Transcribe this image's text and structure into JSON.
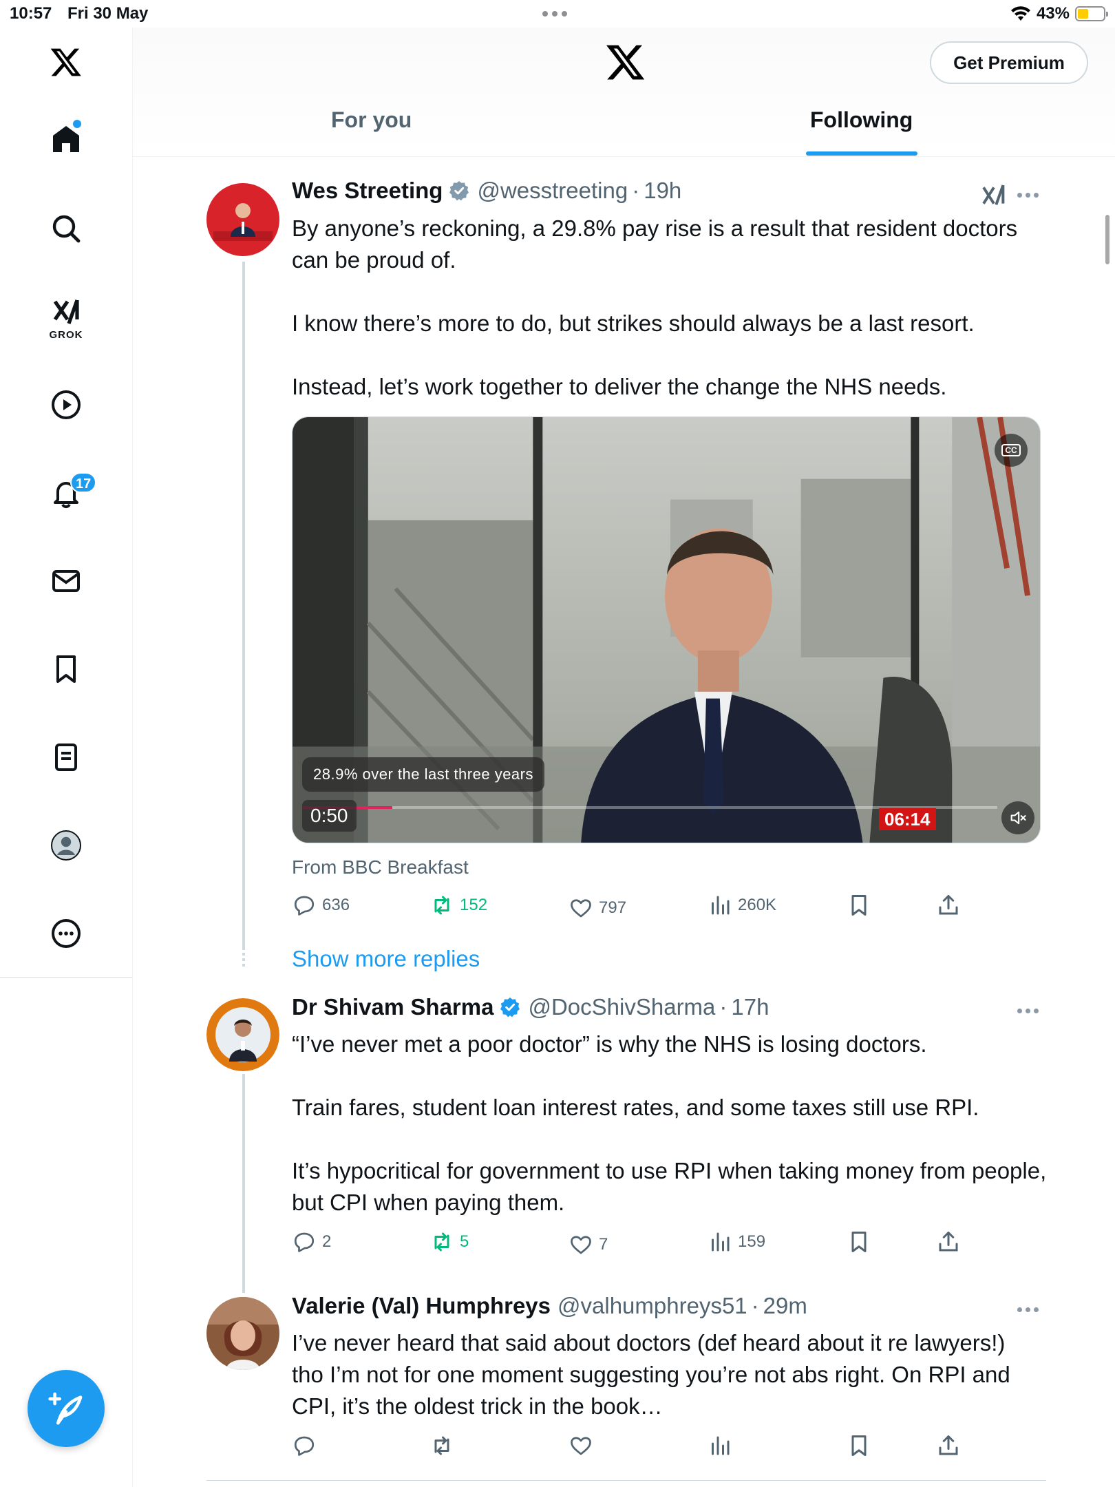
{
  "status_bar": {
    "time": "10:57",
    "date": "Fri 30 May",
    "battery": "43%",
    "battery_level": 0.43
  },
  "sidebar": {
    "items": [
      {
        "name": "home",
        "icon": "home-icon",
        "unread_dot": true
      },
      {
        "name": "explore",
        "icon": "search-icon"
      },
      {
        "name": "grok",
        "icon": "grok-icon",
        "label": "GROK"
      },
      {
        "name": "videos",
        "icon": "play-icon"
      },
      {
        "name": "notifications",
        "icon": "bell-icon",
        "badge": "17"
      },
      {
        "name": "messages",
        "icon": "mail-icon"
      },
      {
        "name": "bookmarks",
        "icon": "bookmark-icon"
      },
      {
        "name": "lists",
        "icon": "list-icon"
      },
      {
        "name": "profile",
        "icon": "profile-icon"
      },
      {
        "name": "more",
        "icon": "more-icon"
      }
    ],
    "compose": "compose-icon"
  },
  "header": {
    "logo": "x-logo-icon",
    "premium_button": "Get Premium",
    "tabs": [
      {
        "label": "For you",
        "active": false
      },
      {
        "label": "Following",
        "active": true
      }
    ]
  },
  "tweets": [
    {
      "name": "Wes Streeting",
      "verified": "gray",
      "handle": "@wesstreeting",
      "time": "19h",
      "body": [
        "By anyone’s reckoning, a 29.8% pay rise is a result that resident doctors can be proud of.",
        "I know there’s more to do, but strikes should always be a last resort.",
        "Instead, let’s work together to deliver the change the NHS needs."
      ],
      "video": {
        "caption": "28.9% over the last three years",
        "elapsed": "0:50",
        "duration_label": "06:14",
        "progress": 0.13,
        "cc": "CC"
      },
      "source": "From BBC Breakfast",
      "stats": {
        "replies": "636",
        "reposts": "152",
        "likes": "797",
        "views": "260K"
      }
    },
    {
      "show_more": "Show more replies"
    },
    {
      "name": "Dr Shivam Sharma",
      "verified": "blue",
      "handle": "@DocShivSharma",
      "time": "17h",
      "body": [
        "“I’ve never met a poor doctor” is why the NHS is losing doctors.",
        "Train fares, student loan interest rates, and some taxes still use RPI.",
        "It’s hypocritical for government to use RPI when taking money from people, but CPI when paying them."
      ],
      "stats": {
        "replies": "2",
        "reposts": "5",
        "likes": "7",
        "views": "159"
      }
    },
    {
      "name": "Valerie (Val) Humphreys",
      "handle": "@valhumphreys51",
      "time": "29m",
      "body": [
        "I’ve never heard that said about doctors (def heard about it re lawyers!) tho I’m not for one moment suggesting you’re not abs right. On RPI and CPI, it’s the oldest trick in the book…"
      ],
      "stats": {
        "replies": "",
        "reposts": "",
        "likes": "",
        "views": ""
      }
    }
  ],
  "colors": {
    "accent": "#1d9bf0",
    "text": "#0f1419",
    "muted": "#536471",
    "repost_green": "#00ba7c",
    "live_red": "#d21414"
  }
}
